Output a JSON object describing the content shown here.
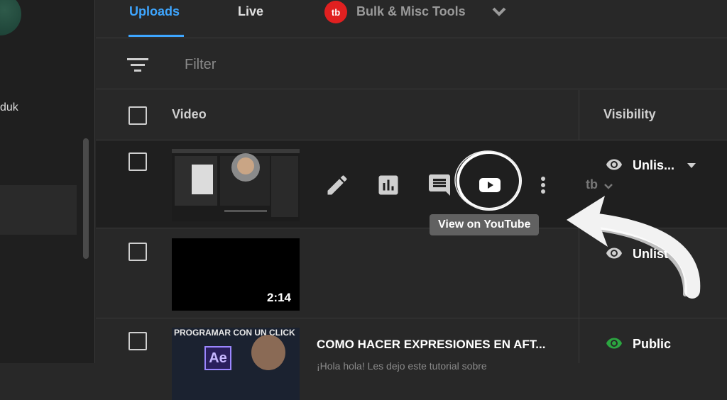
{
  "sidebar": {
    "channel_name": "duk"
  },
  "tabs": {
    "uploads": "Uploads",
    "live": "Live",
    "tb_logo": "tb",
    "bulk": "Bulk & Misc Tools"
  },
  "filter": {
    "placeholder": "Filter"
  },
  "table": {
    "headers": {
      "video": "Video",
      "visibility": "Visibility"
    },
    "rows": [
      {
        "visibility": "Unlis...",
        "visibility_color": "#cfcfcf"
      },
      {
        "duration": "2:14",
        "visibility": "Unlist",
        "visibility_color": "#cfcfcf"
      },
      {
        "title": "COMO HACER EXPRESIONES EN AFT...",
        "description": "¡Hola hola! Les dejo este tutorial sobre",
        "thumb_text": "PROGRAMAR CON UN CLICK",
        "thumb_logo": "Ae",
        "visibility": "Public",
        "visibility_color": "#2ba640"
      }
    ]
  },
  "tooltip": {
    "text": "View on YouTube"
  },
  "row_tb_logo": "tb",
  "icons": {
    "edit": "pencil-icon",
    "analytics": "bar-chart-icon",
    "comments": "comment-icon",
    "youtube": "youtube-play-icon",
    "options": "more-vert-icon",
    "filter": "filter-lines-icon"
  },
  "colors": {
    "accent": "#3ea6ff",
    "public": "#2ba640",
    "brand_red": "#e02020"
  }
}
